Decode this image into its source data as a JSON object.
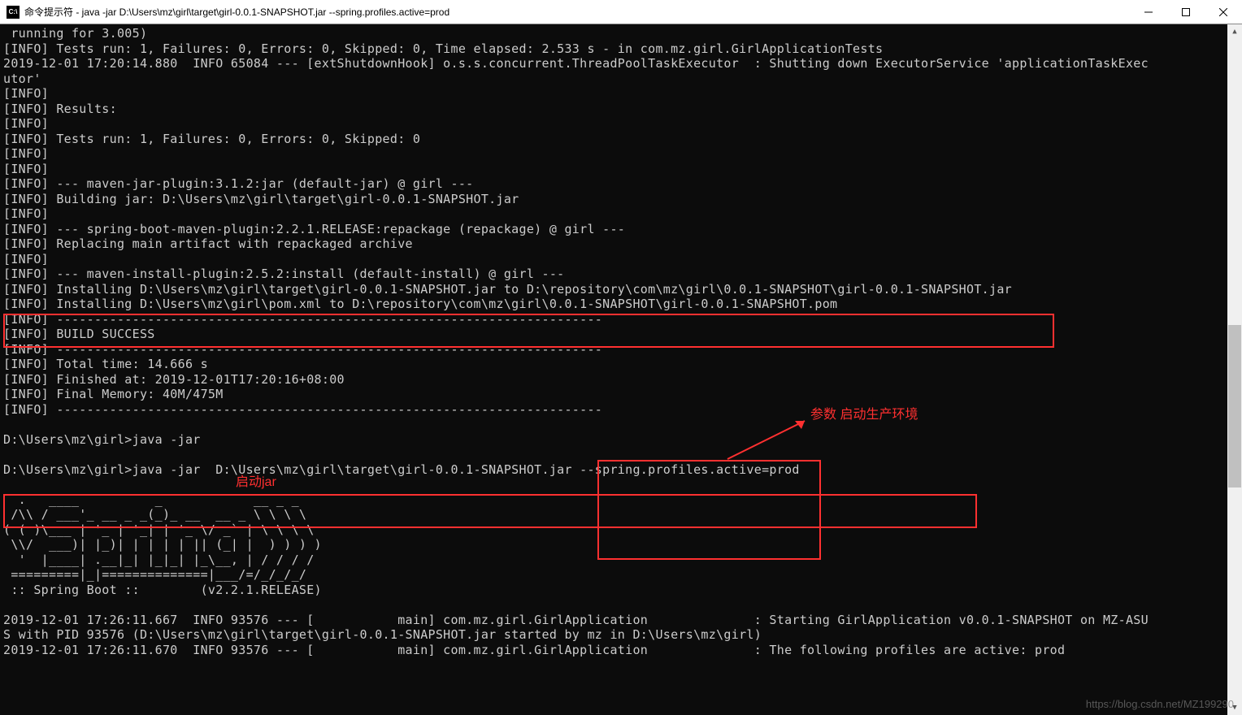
{
  "window": {
    "icon_label": "C:\\",
    "title": "命令提示符 - java  -jar  D:\\Users\\mz\\girl\\target\\girl-0.0.1-SNAPSHOT.jar --spring.profiles.active=prod"
  },
  "annotations": {
    "launch_jar": "启动jar",
    "param_text": "参数 启动生产环境"
  },
  "watermark": "https://blog.csdn.net/MZ199290",
  "terminal_lines": [
    " running for 3.005)",
    "[INFO] Tests run: 1, Failures: 0, Errors: 0, Skipped: 0, Time elapsed: 2.533 s - in com.mz.girl.GirlApplicationTests",
    "2019-12-01 17:20:14.880  INFO 65084 --- [extShutdownHook] o.s.s.concurrent.ThreadPoolTaskExecutor  : Shutting down ExecutorService 'applicationTaskExec",
    "utor'",
    "[INFO]",
    "[INFO] Results:",
    "[INFO]",
    "[INFO] Tests run: 1, Failures: 0, Errors: 0, Skipped: 0",
    "[INFO]",
    "[INFO]",
    "[INFO] --- maven-jar-plugin:3.1.2:jar (default-jar) @ girl ---",
    "[INFO] Building jar: D:\\Users\\mz\\girl\\target\\girl-0.0.1-SNAPSHOT.jar",
    "[INFO]",
    "[INFO] --- spring-boot-maven-plugin:2.2.1.RELEASE:repackage (repackage) @ girl ---",
    "[INFO] Replacing main artifact with repackaged archive",
    "[INFO]",
    "[INFO] --- maven-install-plugin:2.5.2:install (default-install) @ girl ---",
    "[INFO] Installing D:\\Users\\mz\\girl\\target\\girl-0.0.1-SNAPSHOT.jar to D:\\repository\\com\\mz\\girl\\0.0.1-SNAPSHOT\\girl-0.0.1-SNAPSHOT.jar",
    "[INFO] Installing D:\\Users\\mz\\girl\\pom.xml to D:\\repository\\com\\mz\\girl\\0.0.1-SNAPSHOT\\girl-0.0.1-SNAPSHOT.pom",
    "[INFO] ------------------------------------------------------------------------",
    "[INFO] BUILD SUCCESS",
    "[INFO] ------------------------------------------------------------------------",
    "[INFO] Total time: 14.666 s",
    "[INFO] Finished at: 2019-12-01T17:20:16+08:00",
    "[INFO] Final Memory: 40M/475M",
    "[INFO] ------------------------------------------------------------------------",
    "",
    "D:\\Users\\mz\\girl>java -jar",
    "",
    "D:\\Users\\mz\\girl>java -jar  D:\\Users\\mz\\girl\\target\\girl-0.0.1-SNAPSHOT.jar --spring.profiles.active=prod",
    "",
    "  .   ____          _            __ _ _",
    " /\\\\ / ___'_ __ _ _(_)_ __  __ _ \\ \\ \\ \\",
    "( ( )\\___ | '_ | '_| | '_ \\/ _` | \\ \\ \\ \\",
    " \\\\/  ___)| |_)| | | | | || (_| |  ) ) ) )",
    "  '  |____| .__|_| |_|_| |_\\__, | / / / /",
    " =========|_|==============|___/=/_/_/_/",
    " :: Spring Boot ::        (v2.2.1.RELEASE)",
    "",
    "2019-12-01 17:26:11.667  INFO 93576 --- [           main] com.mz.girl.GirlApplication              : Starting GirlApplication v0.0.1-SNAPSHOT on MZ-ASU",
    "S with PID 93576 (D:\\Users\\mz\\girl\\target\\girl-0.0.1-SNAPSHOT.jar started by mz in D:\\Users\\mz\\girl)",
    "2019-12-01 17:26:11.670  INFO 93576 --- [           main] com.mz.girl.GirlApplication              : The following profiles are active: prod"
  ]
}
